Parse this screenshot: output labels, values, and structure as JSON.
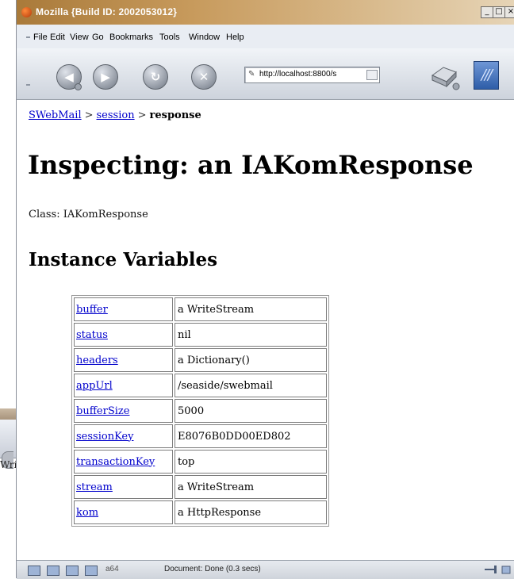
{
  "background_window": {
    "partial_text": "Wrí"
  },
  "titlebar": {
    "title": "Mozilla {Build ID: 2002053012}"
  },
  "menubar": {
    "items": [
      "File",
      "Edit",
      "View",
      "Go",
      "Bookmarks",
      "Tools",
      "Window",
      "Help"
    ]
  },
  "navbar": {
    "url": "http://localhost:8800/s"
  },
  "breadcrumb": {
    "item1": "SWebMail",
    "sep1": ">",
    "item2": "session",
    "sep2": ">",
    "current": "response"
  },
  "page": {
    "title": "Inspecting: an IAKomResponse",
    "class_line": "Class: IAKomResponse",
    "section_heading": "Instance Variables"
  },
  "instance_variables": [
    {
      "name": "buffer",
      "value": "a WriteStream"
    },
    {
      "name": "status",
      "value": "nil"
    },
    {
      "name": "headers",
      "value": "a Dictionary()"
    },
    {
      "name": "appUrl",
      "value": "/seaside/swebmail"
    },
    {
      "name": "bufferSize",
      "value": "5000"
    },
    {
      "name": "sessionKey",
      "value": "E8076B0DD00ED802"
    },
    {
      "name": "transactionKey",
      "value": "top"
    },
    {
      "name": "stream",
      "value": "a WriteStream"
    },
    {
      "name": "kom",
      "value": "a HttpResponse"
    }
  ],
  "statusbar": {
    "zoom_label": "a64",
    "text": "Document: Done (0.3 secs)"
  },
  "colors": {
    "link": "#0000cc",
    "titlebar": "#c79a5c",
    "chrome": "#e9edf3"
  }
}
